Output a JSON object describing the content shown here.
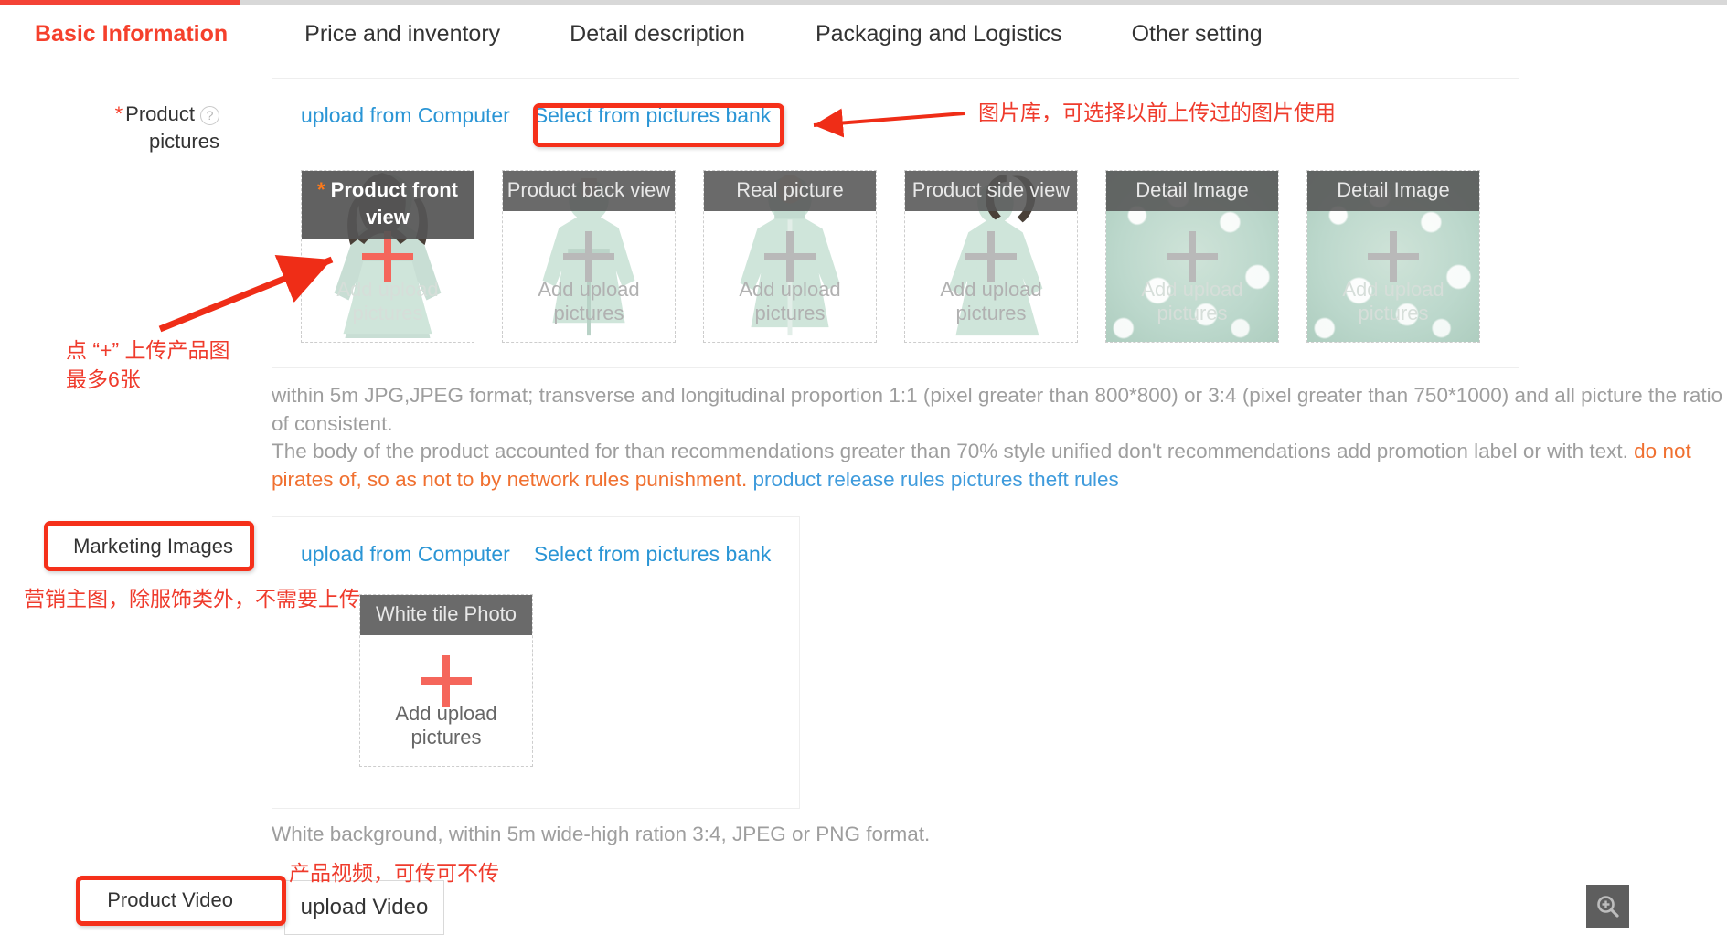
{
  "tabs": [
    {
      "label": "Basic Information",
      "active": true
    },
    {
      "label": "Price and inventory",
      "active": false
    },
    {
      "label": "Detail description",
      "active": false
    },
    {
      "label": "Packaging and Logistics",
      "active": false
    },
    {
      "label": "Other setting",
      "active": false
    }
  ],
  "product_pictures": {
    "label_line1": "Product",
    "label_line2": "pictures",
    "required_marker": "*",
    "help_icon": "question-mark-icon",
    "upload_from_computer": "upload from Computer",
    "select_from_pictures_bank": "Select from pictures bank",
    "add_upload_text": "Add upload\npictures",
    "thumbs": [
      {
        "caption": "Product front view",
        "required": true,
        "add_text": "Add upload pictures",
        "style": "front"
      },
      {
        "caption": "Product back view",
        "required": false,
        "add_text": "Add upload pictures",
        "style": "back"
      },
      {
        "caption": "Real picture",
        "required": false,
        "add_text": "Add upload pictures",
        "style": "real"
      },
      {
        "caption": "Product side view",
        "required": false,
        "add_text": "Add upload pictures",
        "style": "side"
      },
      {
        "caption": "Detail Image",
        "required": false,
        "add_text": "Add upload pictures",
        "style": "detail"
      },
      {
        "caption": "Detail Image",
        "required": false,
        "add_text": "Add upload pictures",
        "style": "detail"
      }
    ],
    "notes": {
      "line1": "within 5m JPG,JPEG format; transverse and longitudinal proportion 1:1 (pixel greater than 800*800) or 3:4 (pixel greater than 750*1000) and all picture the ratio",
      "line2": "of consistent.",
      "line3_grey": "The body of the product accounted for than recommendations greater than 70% style unified don't recommendations add promotion label or with text. ",
      "line3_orange": "do not",
      "line4_orange": "pirates of, so as not to by network rules punishment. ",
      "line4_link": "product release rules pictures theft rules"
    }
  },
  "marketing_images": {
    "label": "Marketing Images",
    "upload_from_computer": "upload from Computer",
    "select_from_pictures_bank": "Select from pictures bank",
    "thumb": {
      "caption": "White tile Photo",
      "add_text_line1": "Add upload",
      "add_text_line2": "pictures"
    },
    "note": "White background, within 5m wide-high ration 3:4, JPEG or PNG format."
  },
  "product_video": {
    "label": "Product Video",
    "upload_button": "upload Video"
  },
  "annotations": {
    "pictures_bank_note": "图片库，可选择以前上传过的图片使用",
    "plus_note_line1": "点 “+” 上传产品图",
    "plus_note_line2": "最多6张",
    "marketing_note": "营销主图，除服饰类外，不需要上传",
    "video_note": "产品视频，可传可不传"
  },
  "zoom_control": {
    "icon": "magnifier-plus-icon"
  },
  "colors": {
    "accent_red": "#f5402c",
    "link_blue": "#2a95d5",
    "annotation_red": "#ef3b2c",
    "note_orange": "#f07030",
    "caption_bar": "#555555"
  }
}
